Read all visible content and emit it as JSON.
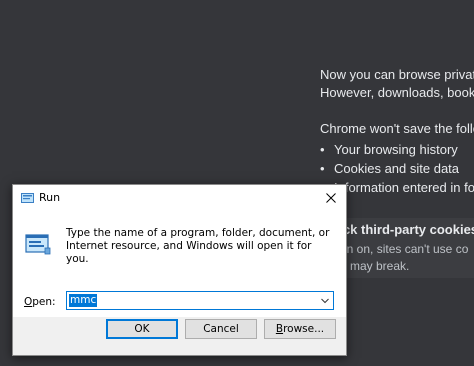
{
  "incognito": {
    "intro_line1": "Now you can browse privately",
    "intro_line2": "However, downloads, bookma",
    "wont_save": "Chrome won't save the follo",
    "items": [
      "Your browsing history",
      "Cookies and site data",
      "Information entered in form"
    ],
    "third_party_title": "Block third-party cookies",
    "third_party_desc1": "When on, sites can't use co",
    "third_party_desc2": "sites may break."
  },
  "run_dialog": {
    "title": "Run",
    "description": "Type the name of a program, folder, document, or Internet resource, and Windows will open it for you.",
    "open_label_key": "O",
    "open_label_rest": "pen:",
    "open_value": "mmc",
    "ok_label": "OK",
    "cancel_label": "Cancel",
    "browse_label_key": "B",
    "browse_label_rest": "rowse..."
  }
}
